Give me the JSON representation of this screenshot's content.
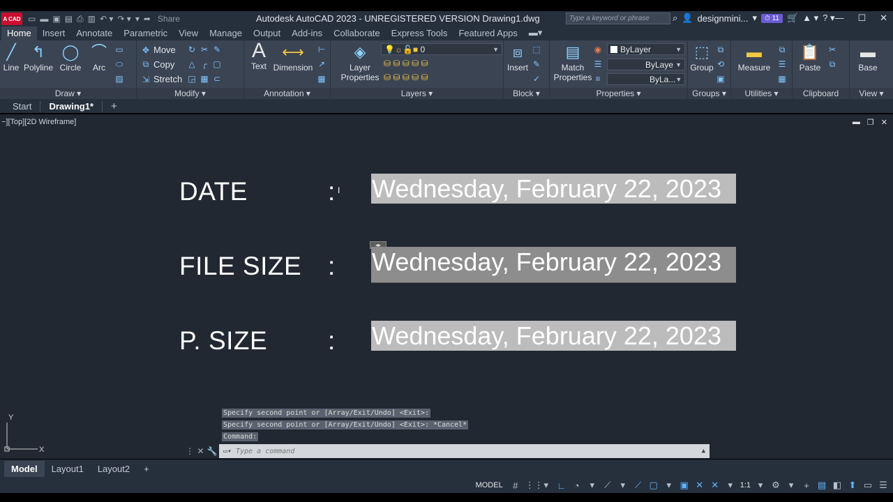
{
  "titlebar": {
    "logo": "A CAD",
    "share": "Share",
    "title": "Autodesk AutoCAD 2023 - UNREGISTERED VERSION    Drawing1.dwg",
    "search_placeholder": "Type a keyword or phrase",
    "user": "designmini...",
    "notifications": "11"
  },
  "ribbon_tabs": [
    "Home",
    "Insert",
    "Annotate",
    "Parametric",
    "View",
    "Manage",
    "Output",
    "Add-ins",
    "Collaborate",
    "Express Tools",
    "Featured Apps"
  ],
  "ribbon": {
    "draw": {
      "title": "Draw",
      "line": "Line",
      "polyline": "Polyline",
      "circle": "Circle",
      "arc": "Arc"
    },
    "modify": {
      "title": "Modify",
      "move": "Move",
      "copy": "Copy",
      "stretch": "Stretch"
    },
    "annotation": {
      "title": "Annotation",
      "text": "Text",
      "dimension": "Dimension"
    },
    "layers": {
      "title": "Layers",
      "layer_properties": "Layer Properties",
      "current_layer": "0"
    },
    "block": {
      "title": "Block",
      "insert": "Insert"
    },
    "properties": {
      "title": "Properties",
      "match": "Match Properties",
      "color": "ByLayer",
      "linetype": "ByLaye",
      "lineweight": "ByLa..."
    },
    "groups": {
      "title": "Groups",
      "group": "Group"
    },
    "utilities": {
      "title": "Utilities",
      "measure": "Measure"
    },
    "clipboard": {
      "title": "Clipboard",
      "paste": "Paste"
    },
    "view": {
      "title": "View",
      "base": "Base"
    }
  },
  "file_tabs": {
    "start": "Start",
    "drawing": "Drawing1*"
  },
  "viewport": {
    "label": "−][Top][2D Wireframe]"
  },
  "drawing": {
    "rows": [
      {
        "label": "DATE",
        "colon": ":",
        "value": "Wednesday, February 22, 2023"
      },
      {
        "label": "FILE SIZE",
        "colon": ":",
        "value": "Wednesday, February 22, 2023"
      },
      {
        "label": "P. SIZE",
        "colon": ":",
        "value": "Wednesday, February 22, 2023"
      }
    ],
    "ucs_x": "X",
    "ucs_y": "Y"
  },
  "command_history": [
    "Specify second point or [Array/Exit/Undo] <Exit>:",
    "Specify second point or [Array/Exit/Undo] <Exit>: *Cancel*",
    "Command:"
  ],
  "command_placeholder": "Type a command",
  "layout_tabs": [
    "Model",
    "Layout1",
    "Layout2"
  ],
  "status": {
    "model": "MODEL",
    "scale": "1:1"
  },
  "colors": {
    "field_bg": "#8d8d8d",
    "field_highlight": "#bcbcbc",
    "canvas": "#212831",
    "ribbon": "#3b4453"
  }
}
